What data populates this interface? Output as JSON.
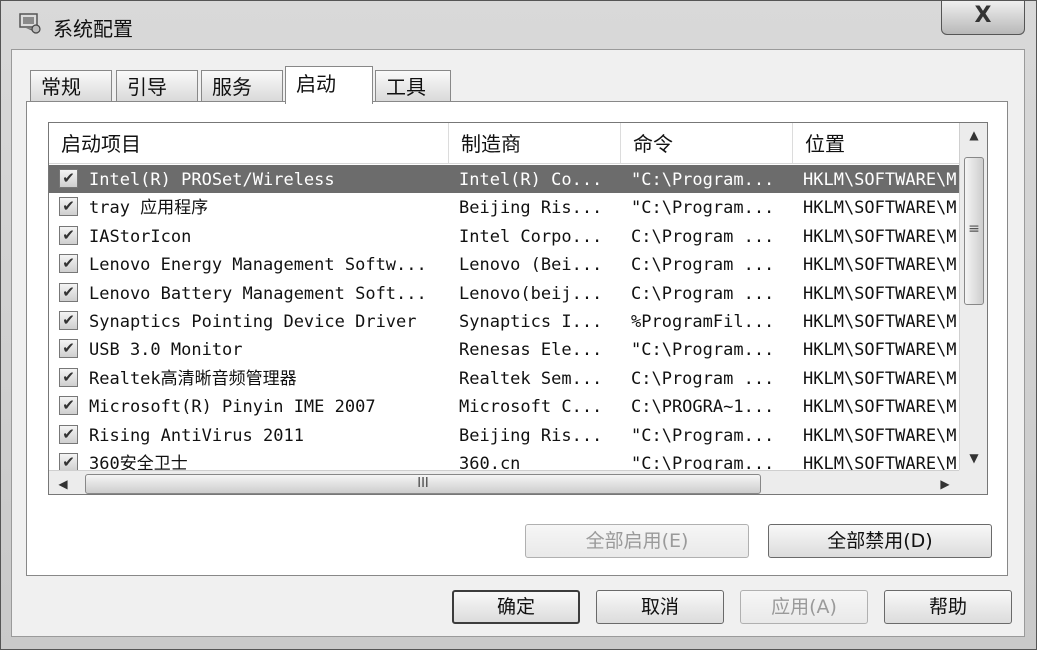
{
  "window": {
    "title": "系统配置",
    "close_label": "X"
  },
  "tabs": [
    {
      "label": "常规",
      "active": false
    },
    {
      "label": "引导",
      "active": false
    },
    {
      "label": "服务",
      "active": false
    },
    {
      "label": "启动",
      "active": true
    },
    {
      "label": "工具",
      "active": false
    }
  ],
  "table": {
    "headers": [
      "启动项目",
      "制造商",
      "命令",
      "位置"
    ],
    "rows": [
      {
        "checked": true,
        "selected": true,
        "item": "Intel(R) PROSet/Wireless",
        "manufacturer": "Intel(R) Co...",
        "command": "\"C:\\Program...",
        "location": "HKLM\\SOFTWARE\\M"
      },
      {
        "checked": true,
        "selected": false,
        "item": "tray 应用程序",
        "manufacturer": "Beijing Ris...",
        "command": "\"C:\\Program...",
        "location": "HKLM\\SOFTWARE\\M"
      },
      {
        "checked": true,
        "selected": false,
        "item": "IAStorIcon",
        "manufacturer": "Intel Corpo...",
        "command": "C:\\Program ...",
        "location": "HKLM\\SOFTWARE\\M"
      },
      {
        "checked": true,
        "selected": false,
        "item": "Lenovo Energy Management Softw...",
        "manufacturer": "Lenovo (Bei...",
        "command": "C:\\Program ...",
        "location": "HKLM\\SOFTWARE\\M"
      },
      {
        "checked": true,
        "selected": false,
        "item": "Lenovo Battery Management Soft...",
        "manufacturer": "Lenovo(beij...",
        "command": "C:\\Program ...",
        "location": "HKLM\\SOFTWARE\\M"
      },
      {
        "checked": true,
        "selected": false,
        "item": "Synaptics Pointing Device Driver",
        "manufacturer": "Synaptics I...",
        "command": "%ProgramFil...",
        "location": "HKLM\\SOFTWARE\\M"
      },
      {
        "checked": true,
        "selected": false,
        "item": "USB 3.0 Monitor",
        "manufacturer": "Renesas Ele...",
        "command": "\"C:\\Program...",
        "location": "HKLM\\SOFTWARE\\M"
      },
      {
        "checked": true,
        "selected": false,
        "item": "Realtek高清晰音频管理器",
        "manufacturer": "Realtek Sem...",
        "command": "C:\\Program ...",
        "location": "HKLM\\SOFTWARE\\M"
      },
      {
        "checked": true,
        "selected": false,
        "item": "Microsoft(R) Pinyin IME 2007",
        "manufacturer": "Microsoft C...",
        "command": "C:\\PROGRA~1...",
        "location": "HKLM\\SOFTWARE\\M"
      },
      {
        "checked": true,
        "selected": false,
        "item": "Rising AntiVirus 2011",
        "manufacturer": "Beijing Ris...",
        "command": "\"C:\\Program...",
        "location": "HKLM\\SOFTWARE\\M"
      },
      {
        "checked": true,
        "selected": false,
        "item": "360安全卫士",
        "manufacturer": "360.cn",
        "command": "\"C:\\Program...",
        "location": "HKLM\\SOFTWARE\\M"
      }
    ]
  },
  "scroll": {
    "grip_v": "≡",
    "grip_h": "III",
    "up": "▲",
    "down": "▼",
    "left": "◀",
    "right": "▶"
  },
  "panel_buttons": {
    "enable_all": "全部启用(E)",
    "disable_all": "全部禁用(D)"
  },
  "dialog_buttons": {
    "ok": "确定",
    "cancel": "取消",
    "apply": "应用(A)",
    "help": "帮助"
  },
  "checkbox_glyph": "✔"
}
